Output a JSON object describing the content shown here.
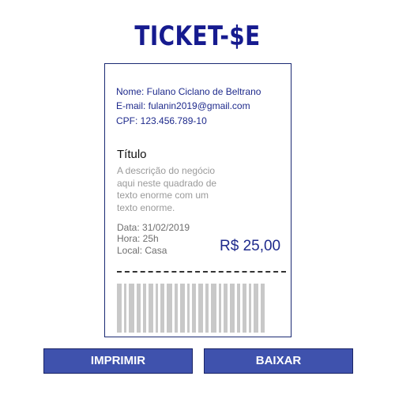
{
  "header": {
    "title": "TICKET-$E"
  },
  "ticket": {
    "name_line": "Nome: Fulano Ciclano de Beltrano",
    "email_line": "E-mail: fulanin2019@gmail.com",
    "cpf_line": "CPF: 123.456.789-10",
    "item_title": "Título",
    "item_description": "A descrição do negócio aqui neste quadrado de texto enorme com um texto enorme.",
    "date_line": "Data: 31/02/2019",
    "hour_line": "Hora: 25h",
    "place_line": "Local: Casa",
    "price": "R$ 25,00"
  },
  "actions": {
    "print_label": "IMPRIMIR",
    "download_label": "BAIXAR"
  },
  "colors": {
    "brand": "#161b8f",
    "button": "#3f52ad",
    "barcode": "#c8c8c8"
  }
}
